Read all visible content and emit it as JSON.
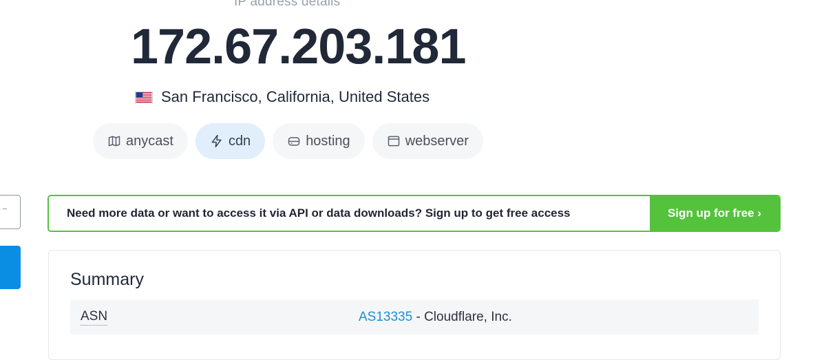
{
  "header": {
    "subtitle": "IP address details",
    "ip": "172.67.203.181",
    "location": "San Francisco, California, United States",
    "flag_icon": "us-flag-icon"
  },
  "tags": [
    {
      "label": "anycast",
      "icon": "map-icon",
      "active": false
    },
    {
      "label": "cdn",
      "icon": "lightning-icon",
      "active": true
    },
    {
      "label": "hosting",
      "icon": "server-icon",
      "active": false
    },
    {
      "label": "webserver",
      "icon": "browser-window-icon",
      "active": false
    }
  ],
  "banner": {
    "text": "Need more data or want to access it via API or data downloads? Sign up to get free access",
    "button_label": "Sign up for free ›"
  },
  "summary": {
    "title": "Summary",
    "rows": [
      {
        "label": "ASN",
        "link": "AS13335",
        "value": " - Cloudflare, Inc."
      }
    ]
  },
  "colors": {
    "accent_green": "#55c23e",
    "link_blue": "#1a8fd6",
    "sidebar_button_blue": "#0a8ee3",
    "active_tag_bg": "#e1eefb"
  }
}
